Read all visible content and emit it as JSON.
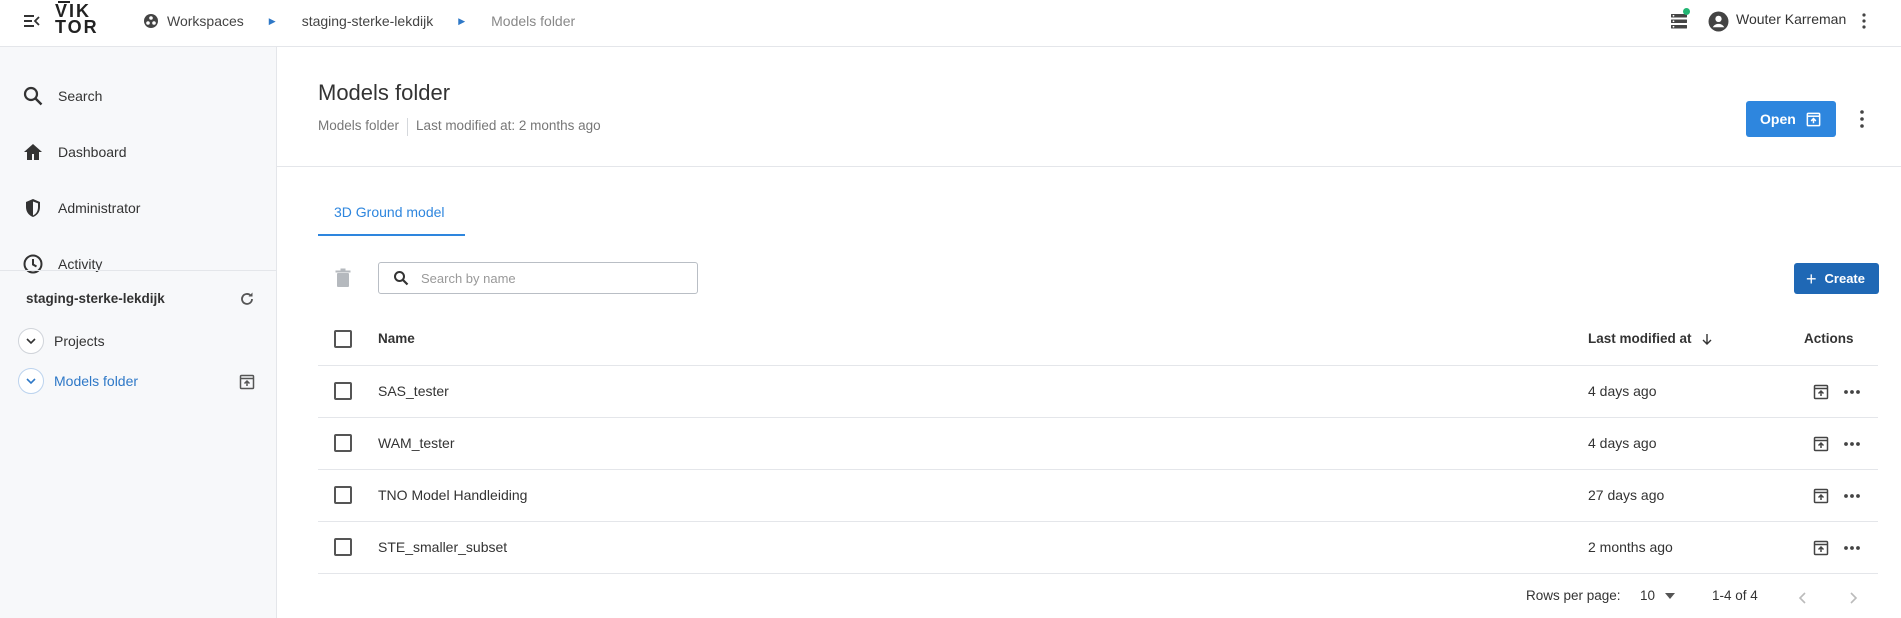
{
  "topbar": {
    "logo_line1": "VIK",
    "logo_line2": "TOR",
    "breadcrumbs": [
      "Workspaces",
      "staging-sterke-lekdijk",
      "Models folder"
    ],
    "user_name": "Wouter Karreman",
    "status_dot_color": "#22b573"
  },
  "sidebar": {
    "nav": [
      {
        "label": "Search",
        "icon": "search-icon"
      },
      {
        "label": "Dashboard",
        "icon": "home-icon"
      },
      {
        "label": "Administrator",
        "icon": "shield-icon"
      },
      {
        "label": "Activity",
        "icon": "clock-icon"
      }
    ],
    "workspace_name": "staging-sterke-lekdijk",
    "tree": [
      {
        "label": "Projects"
      },
      {
        "label": "Models folder"
      }
    ]
  },
  "header": {
    "title": "Models folder",
    "entity_type": "Models folder",
    "last_modified": "Last modified at: 2 months ago",
    "open_label": "Open"
  },
  "tabs": [
    {
      "label": "3D Ground model"
    }
  ],
  "toolbar": {
    "search_placeholder": "Search by name",
    "create_label": "Create"
  },
  "table": {
    "columns": {
      "name": "Name",
      "modified": "Last modified at",
      "actions": "Actions"
    },
    "rows": [
      {
        "name": "SAS_tester",
        "modified": "4 days ago"
      },
      {
        "name": "WAM_tester",
        "modified": "4 days ago"
      },
      {
        "name": "TNO Model Handleiding",
        "modified": "27 days ago"
      },
      {
        "name": "STE_smaller_subset",
        "modified": "2 months ago"
      }
    ]
  },
  "pagination": {
    "rows_per_page_label": "Rows per page:",
    "rows_per_page": "10",
    "range": "1-4 of 4"
  },
  "colors": {
    "accent": "#2e86de",
    "create": "#1f68b5"
  }
}
